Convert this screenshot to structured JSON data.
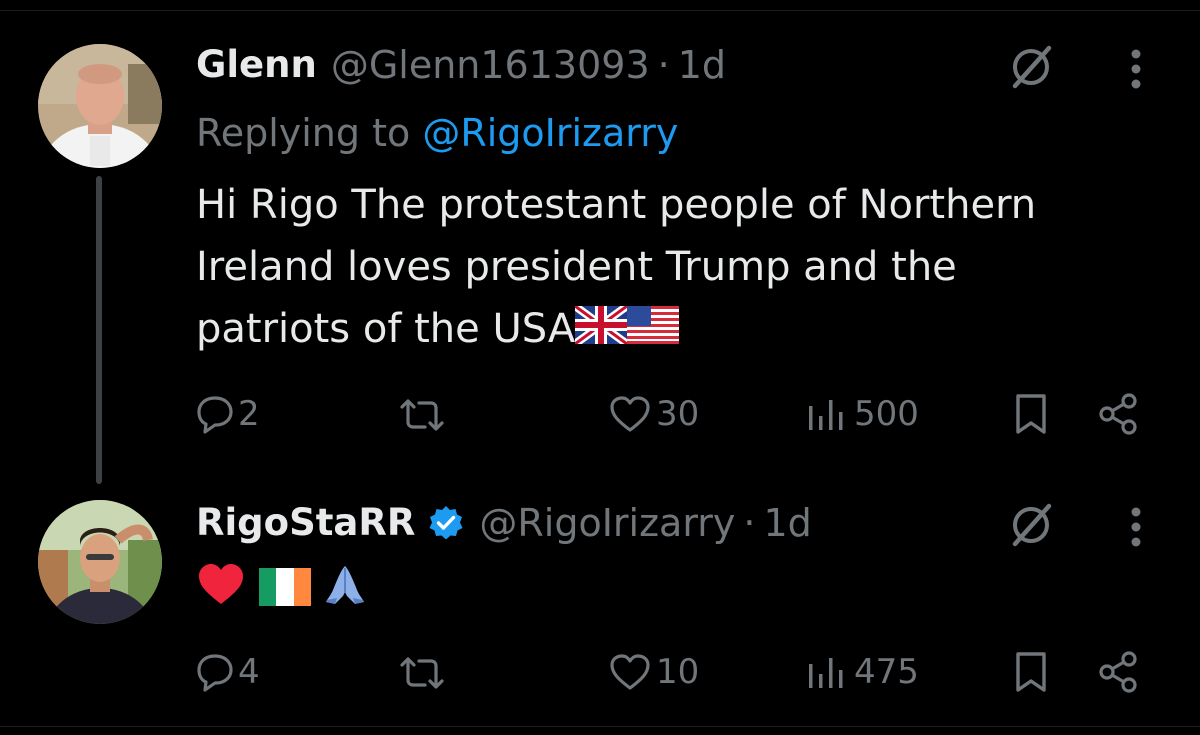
{
  "tweets": [
    {
      "display_name": "Glenn",
      "handle": "@Glenn1613093",
      "separator": "·",
      "time": "1d",
      "replying_prefix": "Replying to ",
      "replying_to": "@RigoIrizarry",
      "text_line1": "Hi Rigo The  protestant people of Northern",
      "text_line2": "Ireland  loves president Trump and the",
      "text_line3": "patriots  of the USA",
      "emojis": [
        "uk-flag",
        "us-flag"
      ],
      "replies": "2",
      "reposts": "",
      "likes": "30",
      "views": "500"
    },
    {
      "display_name": "RigoStaRR",
      "verified": true,
      "handle": "@RigoIrizarry",
      "separator": "·",
      "time": "1d",
      "emojis": [
        "red-heart",
        "ireland-flag",
        "folded-hands"
      ],
      "replies": "4",
      "reposts": "",
      "likes": "10",
      "views": "475"
    }
  ],
  "colors": {
    "background": "#000000",
    "text": "#e7e9ea",
    "secondary": "#71767b",
    "link": "#1d9bf0",
    "thread_line": "#3e4144"
  }
}
